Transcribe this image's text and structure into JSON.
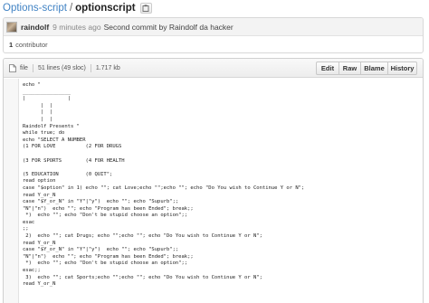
{
  "breadcrumb": {
    "repo": "Options-script",
    "separator": "/",
    "file": "optionscript"
  },
  "commit": {
    "user": "raindolf",
    "time": "9 minutes ago",
    "message": "Second commit by Raindolf da hacker",
    "contributors_count": "1",
    "contributors_label": "contributor"
  },
  "file_header": {
    "type": "file",
    "lines": "51 lines (49 sloc)",
    "size": "1.717 kb"
  },
  "buttons": {
    "edit": "Edit",
    "raw": "Raw",
    "blame": "Blame",
    "history": "History"
  },
  "code_lines": [
    "echo \"",
    "________________",
    "|              |",
    "      |  |",
    "      |  |",
    "      |  |",
    "Raindolf Presents \"",
    "while true; do",
    "echo \"SELECT A NUMBER",
    "(1 FOR LOVE          (2 FOR DRUGS",
    "",
    "(3 FOR SPORTS        (4 FOR HEALTH",
    "",
    "(5 EDUCATION         (0 QUIT\";",
    "read option",
    "case \"$option\" in 1) echo \"\"; cat Love;echo \"\";echo \"\"; echo \"Do You wish to Continue Y or N\";",
    "read Y_or_N",
    "case \"$Y_or_N\" in \"Y\"|\"y\")  echo \"\"; echo \"Supurb\";;",
    "\"N\"|\"n\")  echo \"\"; echo \"Program has been Ended\"; break;;",
    " *)  echo \"\"; echo \"Don't be stupid choose an option\";;",
    "esac",
    ";;",
    " 2)  echo \"\"; cat Drugs; echo \"\";echo \"\"; echo \"Do You wish to Continue Y or N\";",
    "read Y_or_N",
    "case \"$Y_or_N\" in \"Y\"|\"y\")  echo \"\"; echo \"Supurb\";;",
    "\"N\"|\"n\")  echo \"\"; echo \"Program has been Ended\"; break;;",
    " *)  echo \"\"; echo \"Don't be stupid choose an option\";;",
    "esac;;",
    " 3)  echo \"\"; cat Sports;echo \"\";echo \"\"; echo \"Do You wish to Continue Y or N\";",
    "read Y_or_N"
  ]
}
